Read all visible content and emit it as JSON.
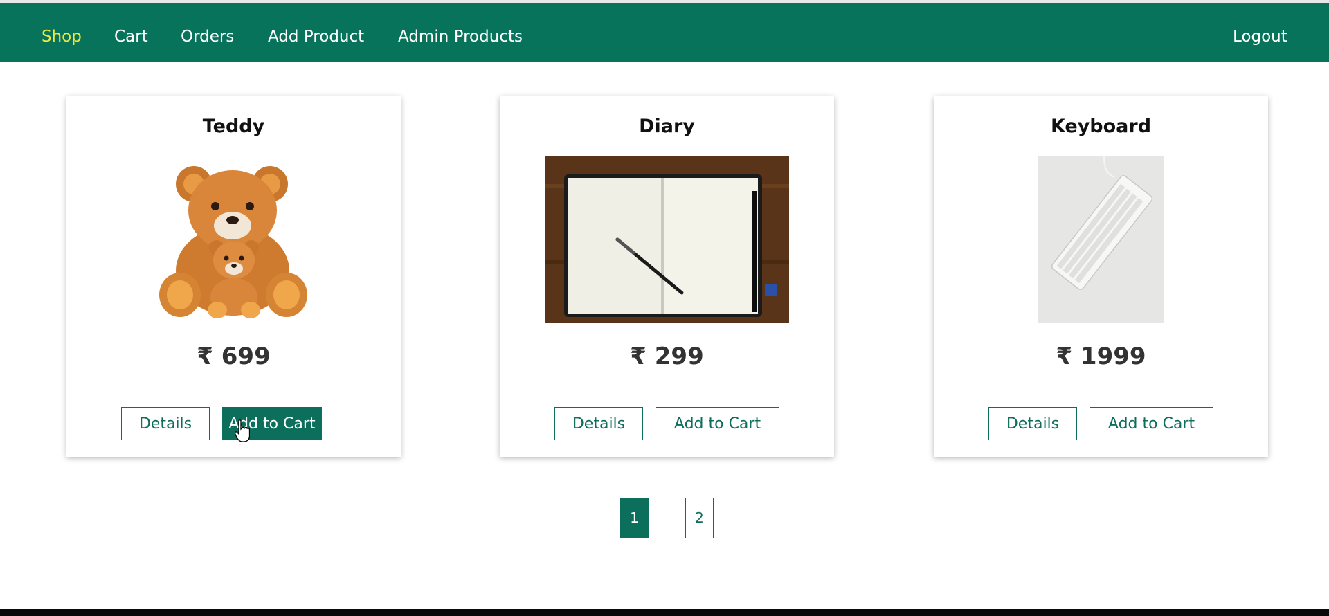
{
  "nav": {
    "items": [
      {
        "label": "Shop",
        "active": true
      },
      {
        "label": "Cart"
      },
      {
        "label": "Orders"
      },
      {
        "label": "Add Product"
      },
      {
        "label": "Admin Products"
      }
    ],
    "logout": "Logout",
    "active_color": "#f2e63b",
    "bg_color": "#08735b"
  },
  "products": [
    {
      "title": "Teddy",
      "price": "₹ 699",
      "image_icon": "teddy-bear-image",
      "details": "Details",
      "add_to_cart": "Add to Cart"
    },
    {
      "title": "Diary",
      "price": "₹ 299",
      "image_icon": "open-notebook-with-pen-image",
      "details": "Details",
      "add_to_cart": "Add to Cart"
    },
    {
      "title": "Keyboard",
      "price": "₹ 1999",
      "image_icon": "white-keyboard-image",
      "details": "Details",
      "add_to_cart": "Add to Cart"
    }
  ],
  "pagination": {
    "pages": [
      "1",
      "2"
    ],
    "current": "1"
  }
}
